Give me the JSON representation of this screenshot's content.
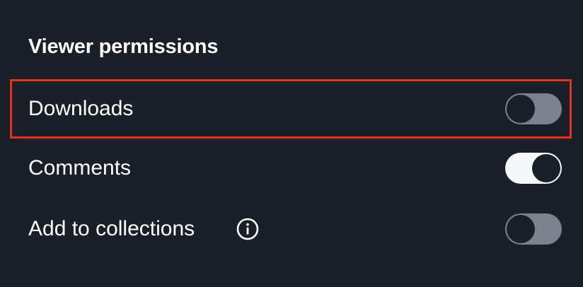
{
  "panel": {
    "title": "Viewer permissions",
    "items": [
      {
        "label": "Downloads",
        "enabled": false,
        "highlighted": true
      },
      {
        "label": "Comments",
        "enabled": true,
        "highlighted": false
      },
      {
        "label": "Add to collections",
        "enabled": false,
        "highlighted": false,
        "icon": "info-icon"
      }
    ]
  },
  "colors": {
    "background": "#1b1f27",
    "highlight_border": "#e8321c",
    "toggle_off_track": "#7b828d",
    "toggle_on_track": "#f6f7f9"
  }
}
